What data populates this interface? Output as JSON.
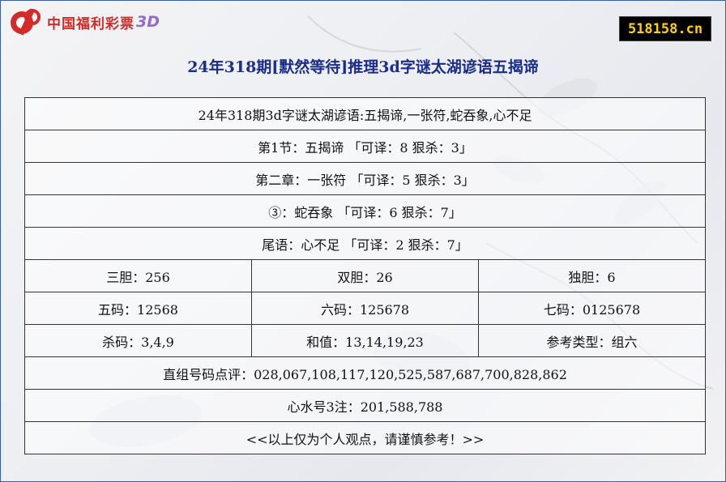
{
  "brand": {
    "name": "中国福利彩票",
    "game": "3D"
  },
  "site_badge": "518158.cn",
  "page_title": "24年318期[默然等待]推理3d字谜太湖谚语五揭谛",
  "rows": {
    "riddle": "24年318期3d字谜太湖谚语:五揭谛,一张符,蛇吞象,心不足",
    "line1": "第1节：五揭谛 「可译：8 狠杀：3」",
    "line2": "第二章：一张符 「可译：5 狠杀：3」",
    "line3": "③：蛇吞象 「可译：6 狠杀：7」",
    "line4": "尾语：心不足 「可译：2 狠杀：7」",
    "dan": [
      "三胆：256",
      "双胆：26",
      "独胆：6"
    ],
    "ma": [
      "五码：12568",
      "六码：125678",
      "七码：0125678"
    ],
    "misc": [
      "杀码：3,4,9",
      "和值：13,14,19,23",
      "参考类型：组六"
    ],
    "zhizu": "直组号码点评：028,067,108,117,120,525,587,687,700,828,862",
    "xinshui": "心水号3注：201,588,788",
    "disclaimer": "<<以上仅为个人观点，请谨慎参考！>>"
  }
}
